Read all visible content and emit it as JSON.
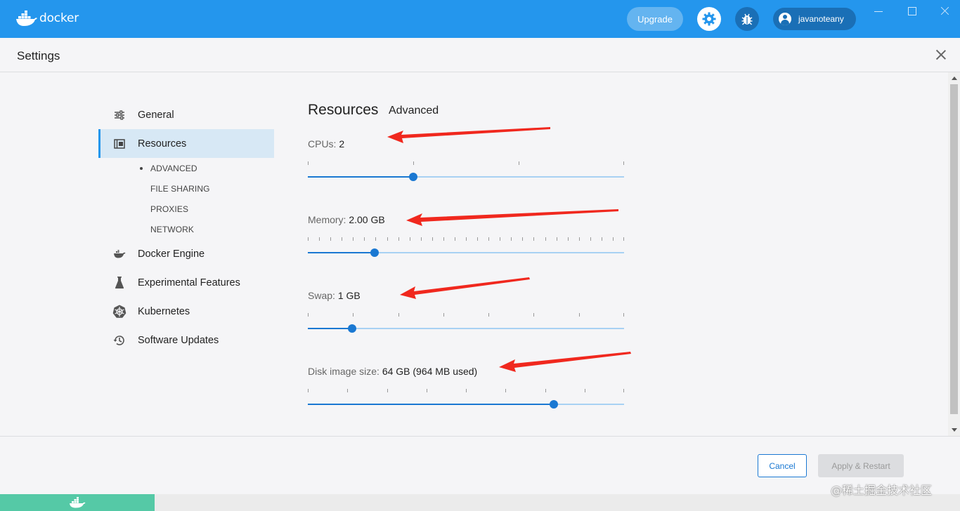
{
  "app": {
    "logo_text": "docker",
    "upgrade_label": "Upgrade",
    "username": "javanoteany",
    "colors": {
      "brand": "#2496ed",
      "accent": "#1a78d2",
      "statusbar": "#55c9a6"
    }
  },
  "settings": {
    "title": "Settings"
  },
  "sidebar": {
    "items": [
      {
        "label": "General",
        "icon": "sliders-icon"
      },
      {
        "label": "Resources",
        "icon": "resources-icon",
        "active": true
      },
      {
        "label": "Docker Engine",
        "icon": "whale-icon"
      },
      {
        "label": "Experimental Features",
        "icon": "flask-icon"
      },
      {
        "label": "Kubernetes",
        "icon": "kubernetes-helm-icon"
      },
      {
        "label": "Software Updates",
        "icon": "history-clock-icon"
      }
    ],
    "subitems": [
      {
        "label": "ADVANCED",
        "active": true
      },
      {
        "label": "FILE SHARING"
      },
      {
        "label": "PROXIES"
      },
      {
        "label": "NETWORK"
      }
    ]
  },
  "main": {
    "tabs": [
      "Resources",
      "Advanced"
    ],
    "cpus": {
      "label": "CPUs:",
      "value": "2",
      "fraction": 0.333
    },
    "memory": {
      "label": "Memory:",
      "value": "2.00 GB",
      "fraction": 0.21
    },
    "swap": {
      "label": "Swap:",
      "value": "1 GB",
      "fraction": 0.14
    },
    "disk": {
      "label": "Disk image size:",
      "value": "64 GB (964 MB used)",
      "fraction": 0.778
    }
  },
  "footer": {
    "cancel_label": "Cancel",
    "apply_label": "Apply & Restart"
  },
  "watermark": "@稀土掘金技术社区"
}
